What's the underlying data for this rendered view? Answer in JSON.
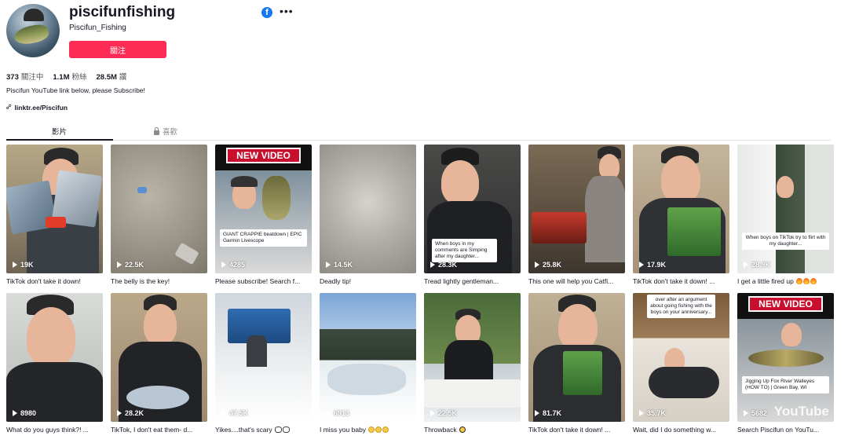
{
  "profile": {
    "username": "piscifunfishing",
    "nickname": "Piscifun_Fishing",
    "follow_label": "關注",
    "stats": [
      {
        "num": "373",
        "label": "關注中"
      },
      {
        "num": "1.1M",
        "label": "粉絲"
      },
      {
        "num": "28.5M",
        "label": "讚"
      }
    ],
    "bio": "Piscifun YouTube link below, please Subscribe!",
    "link": "linktr.ee/Piscifun",
    "share_icon": "facebook-icon",
    "more_icon": "more-options-icon"
  },
  "tabs": [
    {
      "label": "影片",
      "active": true
    },
    {
      "label": "喜歡",
      "active": false,
      "icon": "lock-icon"
    }
  ],
  "videos": [
    {
      "views": "19K",
      "caption": "TikTok don't take it down!"
    },
    {
      "views": "22.5K",
      "caption": "The belly is the key!"
    },
    {
      "views": "4285",
      "caption": "Please subscribe! Search f...",
      "banner": "NEW VIDEO",
      "overlay": "GIANT CRAPPIE beatdown | EPIC Garmin Livescope"
    },
    {
      "views": "14.5K",
      "caption": "Deadly tip!"
    },
    {
      "views": "28.3K",
      "caption": "Tread lightly gentleman...",
      "overlay": "When boys in my comments are Simping after my daughter..."
    },
    {
      "views": "25.8K",
      "caption": "This one will help you Catfi..."
    },
    {
      "views": "17.9K",
      "caption": "TikTok don't take it down! ..."
    },
    {
      "views": "28.9K",
      "caption": "I get a little fired up",
      "emoji": "fire",
      "emoji_count": 3,
      "overlay": "When boys on TikTok try to flirt with my daughter..."
    },
    {
      "views": "8980",
      "caption": "What do you guys think?! ..."
    },
    {
      "views": "28.2K",
      "caption": "TikTok, I don't eat them- d..."
    },
    {
      "views": "47.5K",
      "caption": "Yikes....that's scary",
      "emoji": "eyes",
      "emoji_count": 2
    },
    {
      "views": "6913",
      "caption": "I miss you baby",
      "emoji": "sad",
      "emoji_count": 3
    },
    {
      "views": "22.5K",
      "caption": "Throwback",
      "emoji": "sun",
      "emoji_count": 1
    },
    {
      "views": "81.7K",
      "caption": "TikTok don't take it down! ..."
    },
    {
      "views": "35.7K",
      "caption": "Wait, did I do something w...",
      "overlay": "over after an argument about going fishing with the boys on your anniversary..."
    },
    {
      "views": "5682",
      "caption": "Search Piscifun on YouTu...",
      "banner": "NEW VIDEO",
      "overlay": "Jigging Up Fox River Walleyes (HOW TO) | Green Bay, WI",
      "watermark": "YouTube"
    }
  ]
}
